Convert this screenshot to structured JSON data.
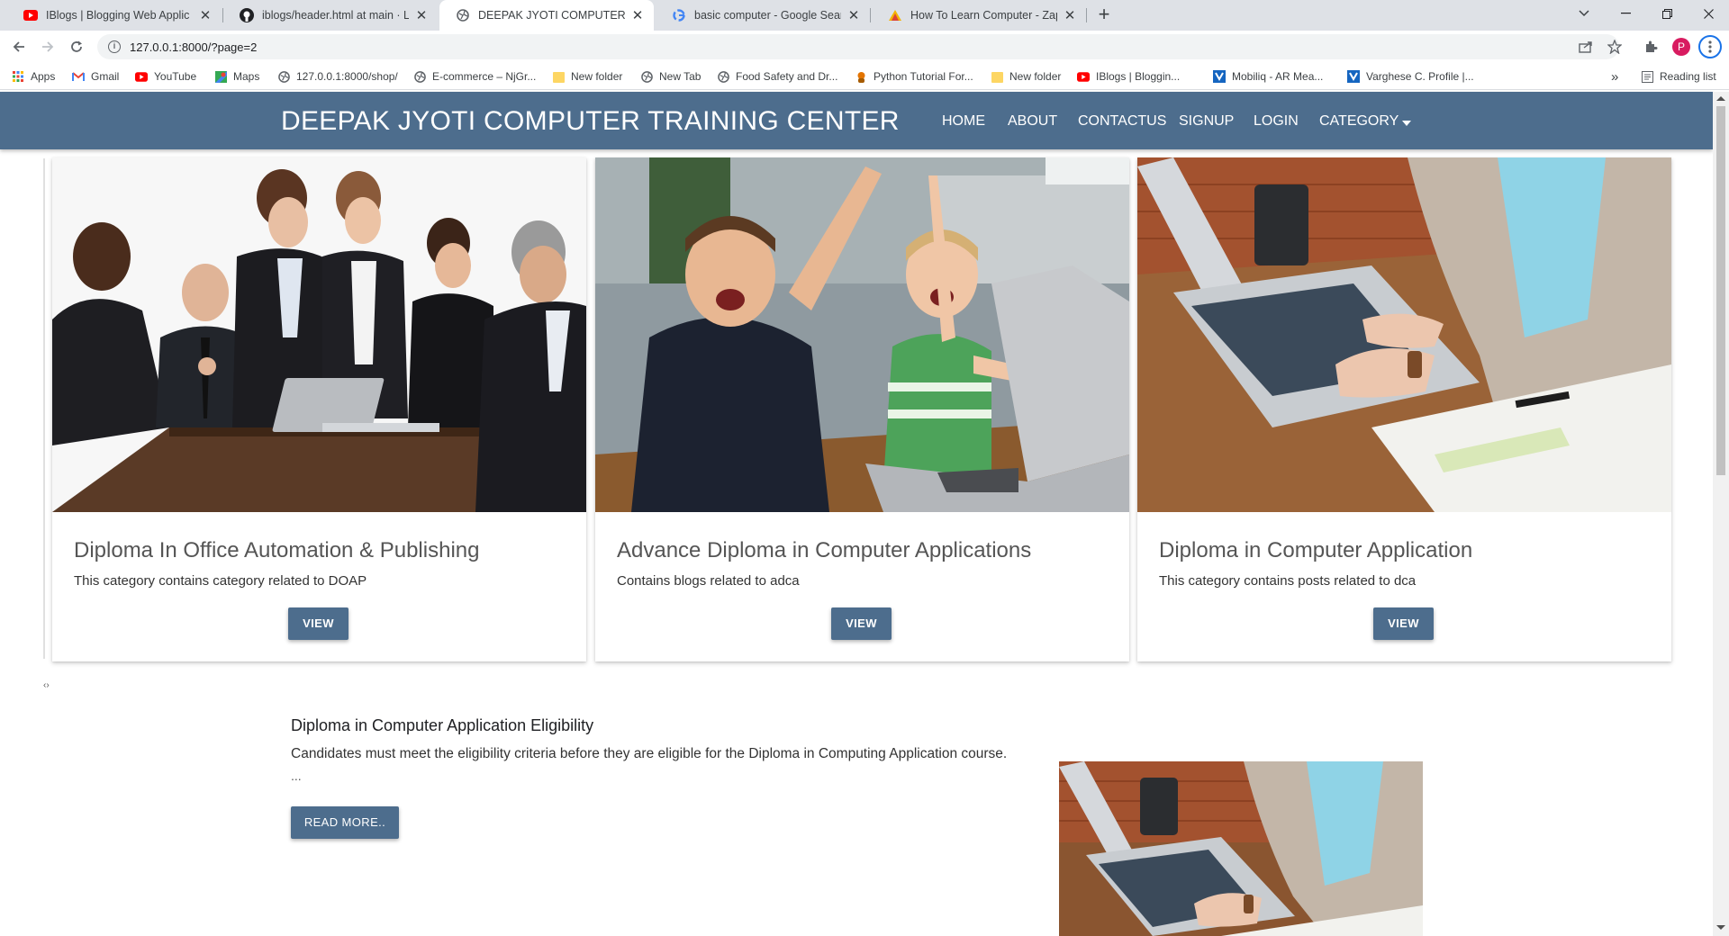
{
  "browser": {
    "tabs": [
      {
        "title": "IBlogs | Blogging Web Applic",
        "icon": "youtube-icon",
        "active": false
      },
      {
        "title": "iblogs/header.html at main · Lea",
        "icon": "github-icon",
        "active": false
      },
      {
        "title": "DEEPAK JYOTI COMPUTER TRAIN",
        "icon": "globe-icon",
        "active": true
      },
      {
        "title": "basic computer - Google Search",
        "icon": "google-icon",
        "active": false
      },
      {
        "title": "How To Learn Computer - ZapMe",
        "icon": "zapmeta-icon",
        "active": false
      }
    ],
    "new_tab": "+",
    "url": "127.0.0.1:8000/?page=2",
    "profile_initial": "P",
    "bookmarks": [
      {
        "label": "Apps",
        "icon": "apps-grid-icon"
      },
      {
        "label": "Gmail",
        "icon": "gmail-icon"
      },
      {
        "label": "YouTube",
        "icon": "youtube-icon"
      },
      {
        "label": "Maps",
        "icon": "maps-icon"
      },
      {
        "label": "127.0.0.1:8000/shop/",
        "icon": "globe-icon"
      },
      {
        "label": "E-commerce – NjGr...",
        "icon": "globe-icon"
      },
      {
        "label": "New folder",
        "icon": "folder-icon"
      },
      {
        "label": "New Tab",
        "icon": "globe-icon"
      },
      {
        "label": "Food Safety and Dr...",
        "icon": "globe-icon"
      },
      {
        "label": "Python Tutorial For...",
        "icon": "python-icon"
      },
      {
        "label": "New folder",
        "icon": "folder-icon"
      },
      {
        "label": "IBlogs | Bloggin...",
        "icon": "youtube-icon"
      },
      {
        "label": "Mobiliq - AR Mea...",
        "icon": "mobiliq-icon"
      },
      {
        "label": "Varghese C. Profile |...",
        "icon": "mobiliq-icon"
      }
    ],
    "more_bookmarks": "»",
    "reading_list": "Reading list"
  },
  "site": {
    "brand": "DEEPAK JYOTI COMPUTER TRAINING CENTER",
    "nav": [
      "HOME",
      "ABOUT",
      "CONTACTUS",
      "SIGNUP",
      "LOGIN",
      "CATEGORY"
    ],
    "accent_color": "#4d6d8d"
  },
  "cards": [
    {
      "title": "Diploma In Office Automation & Publishing",
      "text": "This category contains category related to DOAP",
      "button": "VIEW",
      "image": "business-meeting-photo"
    },
    {
      "title": "Advance Diploma in Computer Applications",
      "text": "Contains blogs related to adca",
      "button": "VIEW",
      "image": "kids-laptop-photo"
    },
    {
      "title": "Diploma in Computer Application",
      "text": "This category contains posts related to dca",
      "button": "VIEW",
      "image": "laptop-typing-photo"
    }
  ],
  "carousel_glyph": "‹›",
  "post": {
    "title": "Diploma in Computer Application Eligibility",
    "text": "Candidates must meet the eligibility criteria before they are eligible for the Diploma in Computing Application course.",
    "ellipsis": "...",
    "button": "READ MORE..",
    "image": "laptop-typing-photo"
  }
}
